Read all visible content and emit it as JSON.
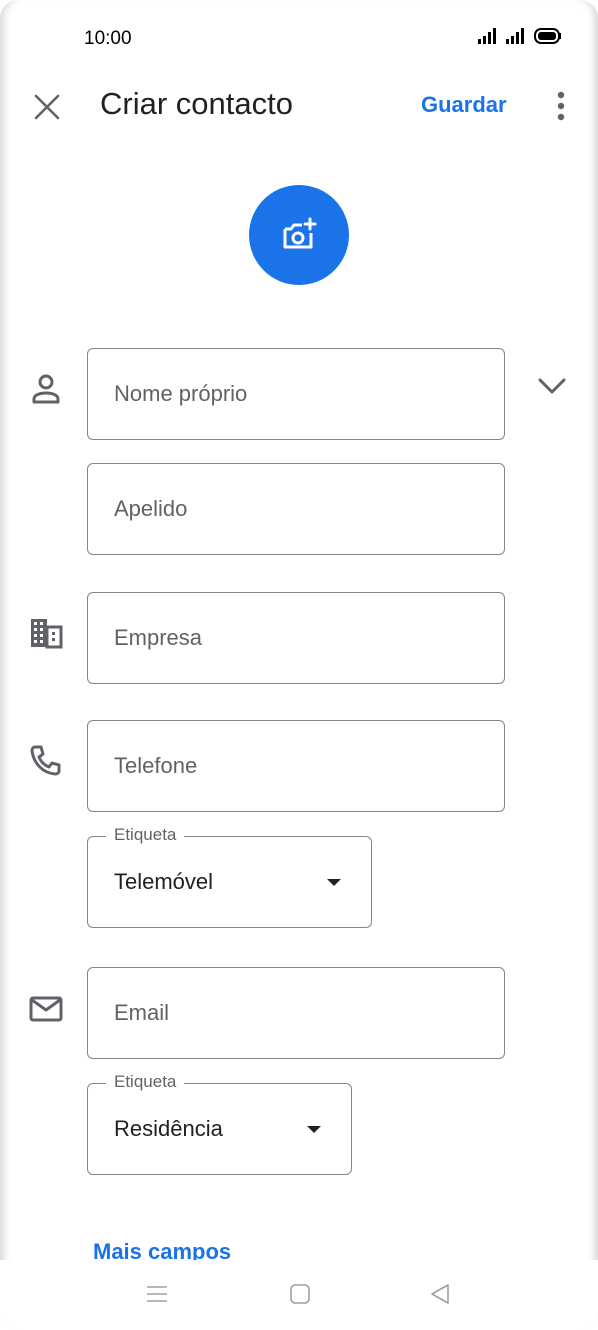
{
  "status_bar": {
    "time": "10:00"
  },
  "header": {
    "title": "Criar contacto",
    "save_label": "Guardar"
  },
  "form": {
    "first_name_placeholder": "Nome próprio",
    "last_name_placeholder": "Apelido",
    "company_placeholder": "Empresa",
    "phone_placeholder": "Telefone",
    "phone_label_legend": "Etiqueta",
    "phone_label_value": "Telemóvel",
    "email_placeholder": "Email",
    "email_label_legend": "Etiqueta",
    "email_label_value": "Residência",
    "more_fields_label": "Mais campos"
  },
  "icons": {
    "close": "close-icon",
    "more": "more-vert-icon",
    "photo": "add-photo-icon",
    "person": "person-icon",
    "company": "building-icon",
    "phone": "phone-icon",
    "email": "mail-icon",
    "expand": "chevron-down-icon"
  },
  "colors": {
    "accent": "#1a73e8",
    "icon": "#5f6368",
    "border": "#80868b"
  }
}
